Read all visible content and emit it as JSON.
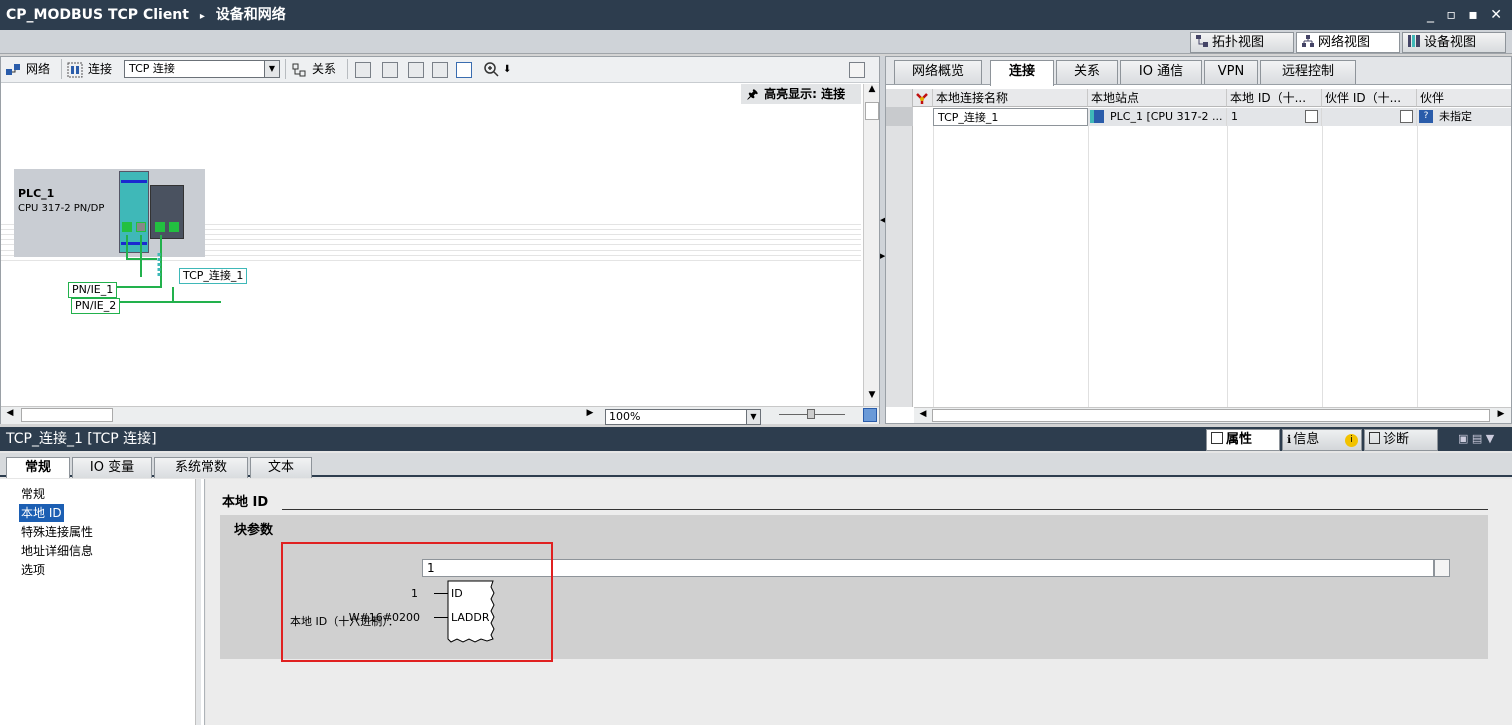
{
  "window": {
    "title": "CP_MODBUS TCP Client",
    "breadcrumb_sep": "▸",
    "section": "设备和网络",
    "controls": "_ ▫ ▪ ✕"
  },
  "views": [
    {
      "label": "拓扑视图",
      "icon": "topology-icon",
      "active": false
    },
    {
      "label": "网络视图",
      "icon": "network-view-icon",
      "active": true
    },
    {
      "label": "设备视图",
      "icon": "device-view-icon",
      "active": false
    }
  ],
  "network_toolbar": {
    "network_label": "网络",
    "connections_label": "连接",
    "connection_type": "TCP 连接",
    "relations_label": "关系",
    "highlight_label": "高亮显示: 连接",
    "zoom": "100%"
  },
  "canvas": {
    "plc_name": "PLC_1",
    "plc_type": "CPU 317-2 PN/DP",
    "connection_label": "TCP_连接_1",
    "subnet1": "PN/IE_1",
    "subnet2": "PN/IE_2"
  },
  "right_tabs": [
    "网络概览",
    "连接",
    "关系",
    "IO 通信",
    "VPN",
    "远程控制"
  ],
  "right_active_tab": "连接",
  "conn_table": {
    "headers": [
      "本地连接名称",
      "本地站点",
      "本地 ID（十...",
      "伙伴 ID（十...",
      "伙伴"
    ],
    "rows": [
      {
        "name": "TCP_连接_1",
        "station": "PLC_1 [CPU 317-2 ...",
        "local_id": "1",
        "partner_id": "",
        "partner": "未指定"
      }
    ]
  },
  "inspector": {
    "title": "TCP_连接_1 [TCP 连接]",
    "panel_tabs": [
      {
        "label": "属性",
        "active": true
      },
      {
        "label": "信息",
        "active": false
      },
      {
        "label": "诊断",
        "active": false
      }
    ],
    "tabs": [
      "常规",
      "IO 变量",
      "系统常数",
      "文本"
    ],
    "active_tab": "常规",
    "nav": [
      "常规",
      "本地 ID",
      "特殊连接属性",
      "地址详细信息",
      "选项"
    ],
    "nav_selected": "本地 ID",
    "section_title": "本地 ID",
    "group_title": "块参数",
    "field_label": "本地 ID（十六进制）：",
    "field_value": "1",
    "block": {
      "id_value": "1",
      "id_pin": "ID",
      "laddr_value": "W#16#0200",
      "laddr_pin": "LADDR"
    }
  },
  "colors": {
    "titlebar": "#2d3d4e",
    "subnet_green": "#22b14c",
    "highlight_red": "#e02020",
    "selection_blue": "#1c5fb3",
    "cpu_teal": "#3fb8b8"
  }
}
